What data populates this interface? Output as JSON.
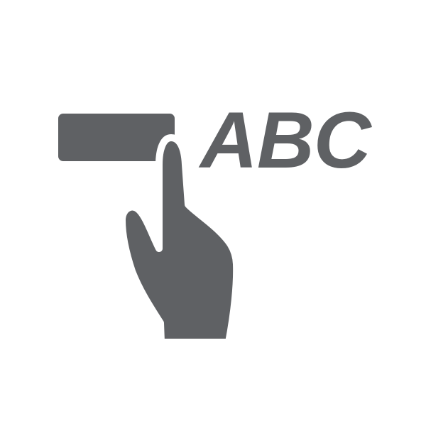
{
  "icon": {
    "label_text": "ABC",
    "bar_icon": "text-field-bar",
    "hand_icon": "pointing-hand-tap",
    "colors": {
      "icon_gray": "#5f6164",
      "background": "#ffffff"
    }
  }
}
